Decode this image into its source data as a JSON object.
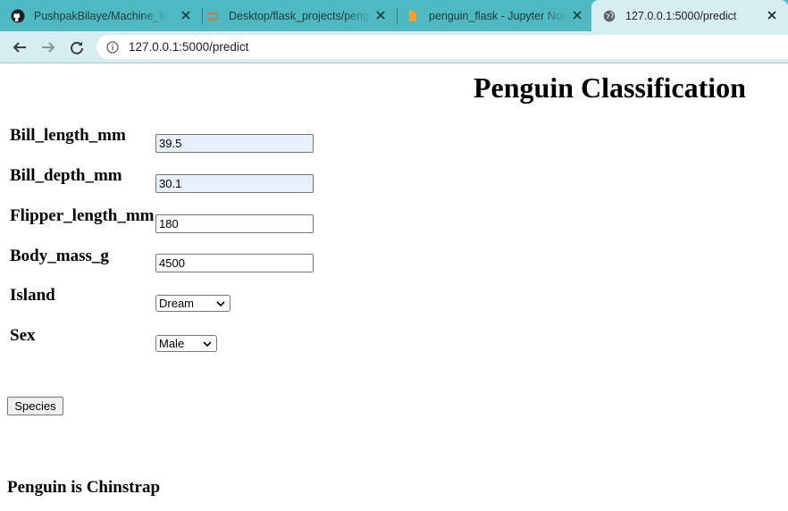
{
  "browser": {
    "tabs": [
      {
        "label": "PushpakBilaye/Machine_learning",
        "favicon": "github-icon",
        "active": false
      },
      {
        "label": "Desktop/flask_projects/penguin",
        "favicon": "jupyter-icon",
        "active": false
      },
      {
        "label": "penguin_flask - Jupyter Notebook",
        "favicon": "notebook-icon",
        "active": false
      },
      {
        "label": "127.0.0.1:5000/predict",
        "favicon": "globe-icon",
        "active": true
      }
    ],
    "url": "127.0.0.1:5000/predict"
  },
  "page": {
    "title": "Penguin Classification",
    "fields": [
      {
        "label": "Bill_length_mm",
        "value": "39.5"
      },
      {
        "label": "Bill_depth_mm",
        "value": "30.1"
      },
      {
        "label": "Flipper_length_mm",
        "value": "180"
      },
      {
        "label": "Body_mass_g",
        "value": "4500"
      }
    ],
    "island": {
      "label": "Island",
      "selected": "Dream"
    },
    "sex": {
      "label": "Sex",
      "selected": "Male"
    },
    "submit_label": "Species",
    "result": "Penguin is Chinstrap"
  },
  "colors": {
    "tabstrip": "#4fb9c1",
    "toolbar": "#d7eef0",
    "autofill": "#e8f0fe"
  }
}
